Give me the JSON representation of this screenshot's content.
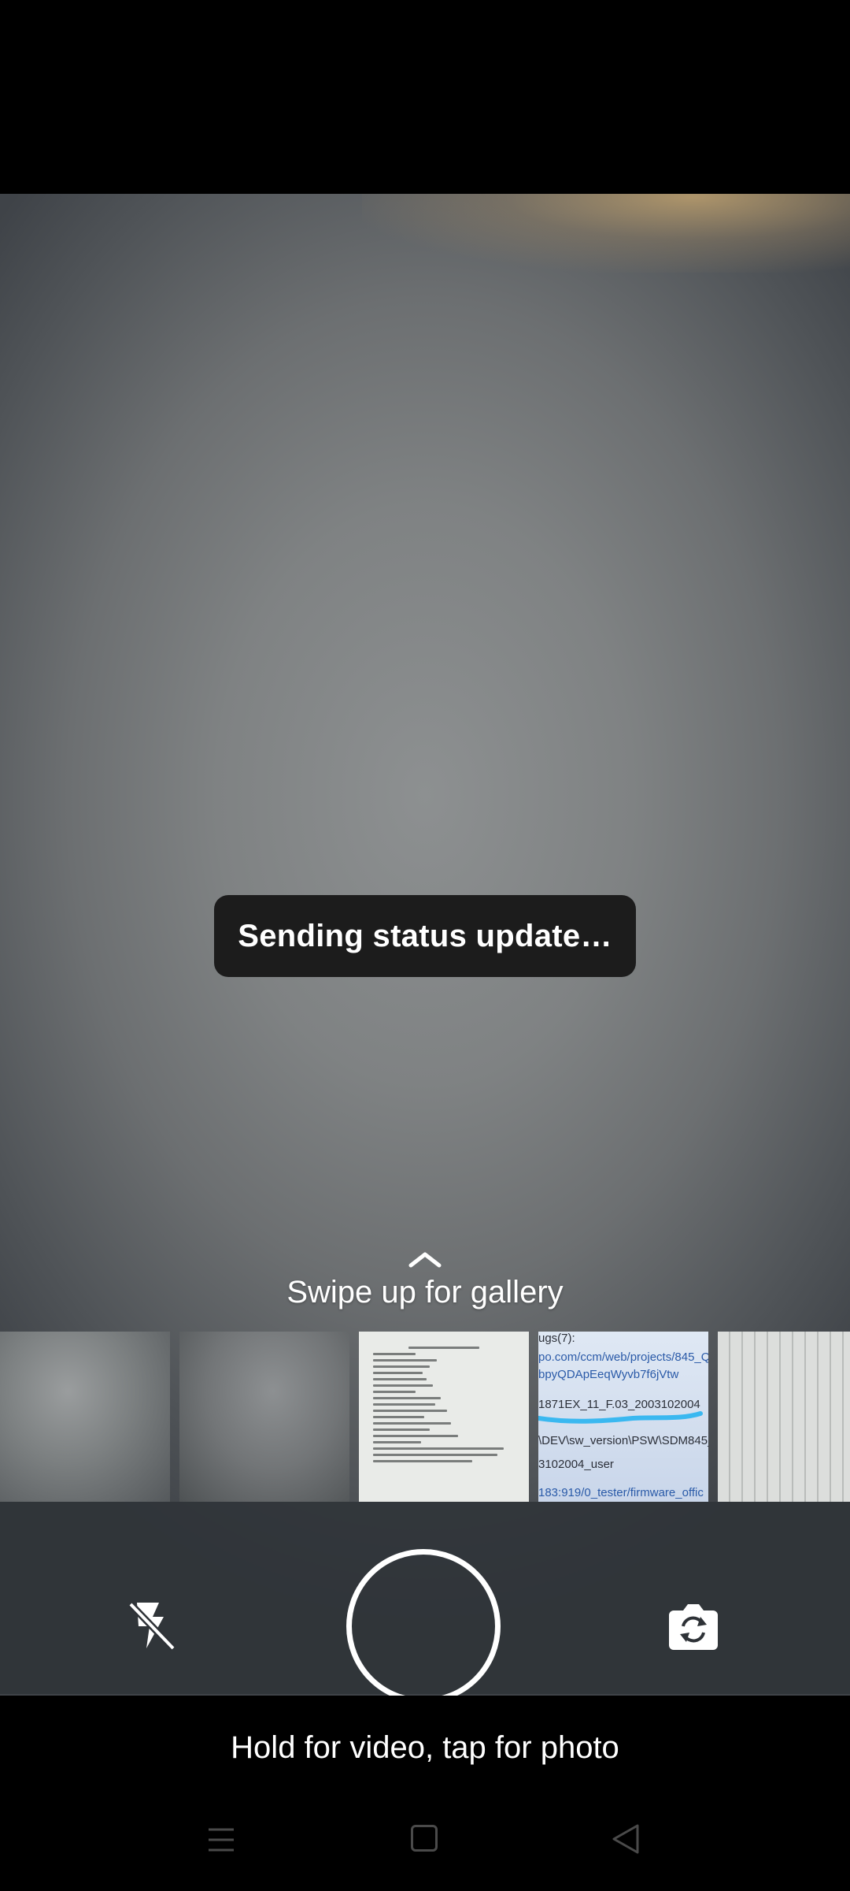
{
  "toast": {
    "text": "Sending status update…"
  },
  "gallery": {
    "hint": "Swipe up for gallery",
    "thumbnails": [
      {
        "kind": "blurred-photo"
      },
      {
        "kind": "blurred-photo"
      },
      {
        "kind": "document-photo"
      },
      {
        "kind": "screen-photo",
        "lines": [
          "ugs(7):",
          "po.com/ccm/web/projects/845_Q",
          "bpyQDApEeqWyvb7f6jVtw",
          "1871EX_11_F.03_2003102004",
          "\\DEV\\sw_version\\PSW\\SDM845_",
          "3102004_user",
          "183:919/0_tester/firmware_offic"
        ]
      },
      {
        "kind": "sheet-photo"
      }
    ]
  },
  "controls": {
    "flash_icon": "flash-off-icon",
    "shutter_icon": "shutter-button",
    "switch_icon": "switch-camera-icon"
  },
  "capture_hint": "Hold for video, tap for photo",
  "navigation": {
    "recent_icon": "recent-apps-icon",
    "home_icon": "home-icon",
    "back_icon": "back-icon"
  }
}
